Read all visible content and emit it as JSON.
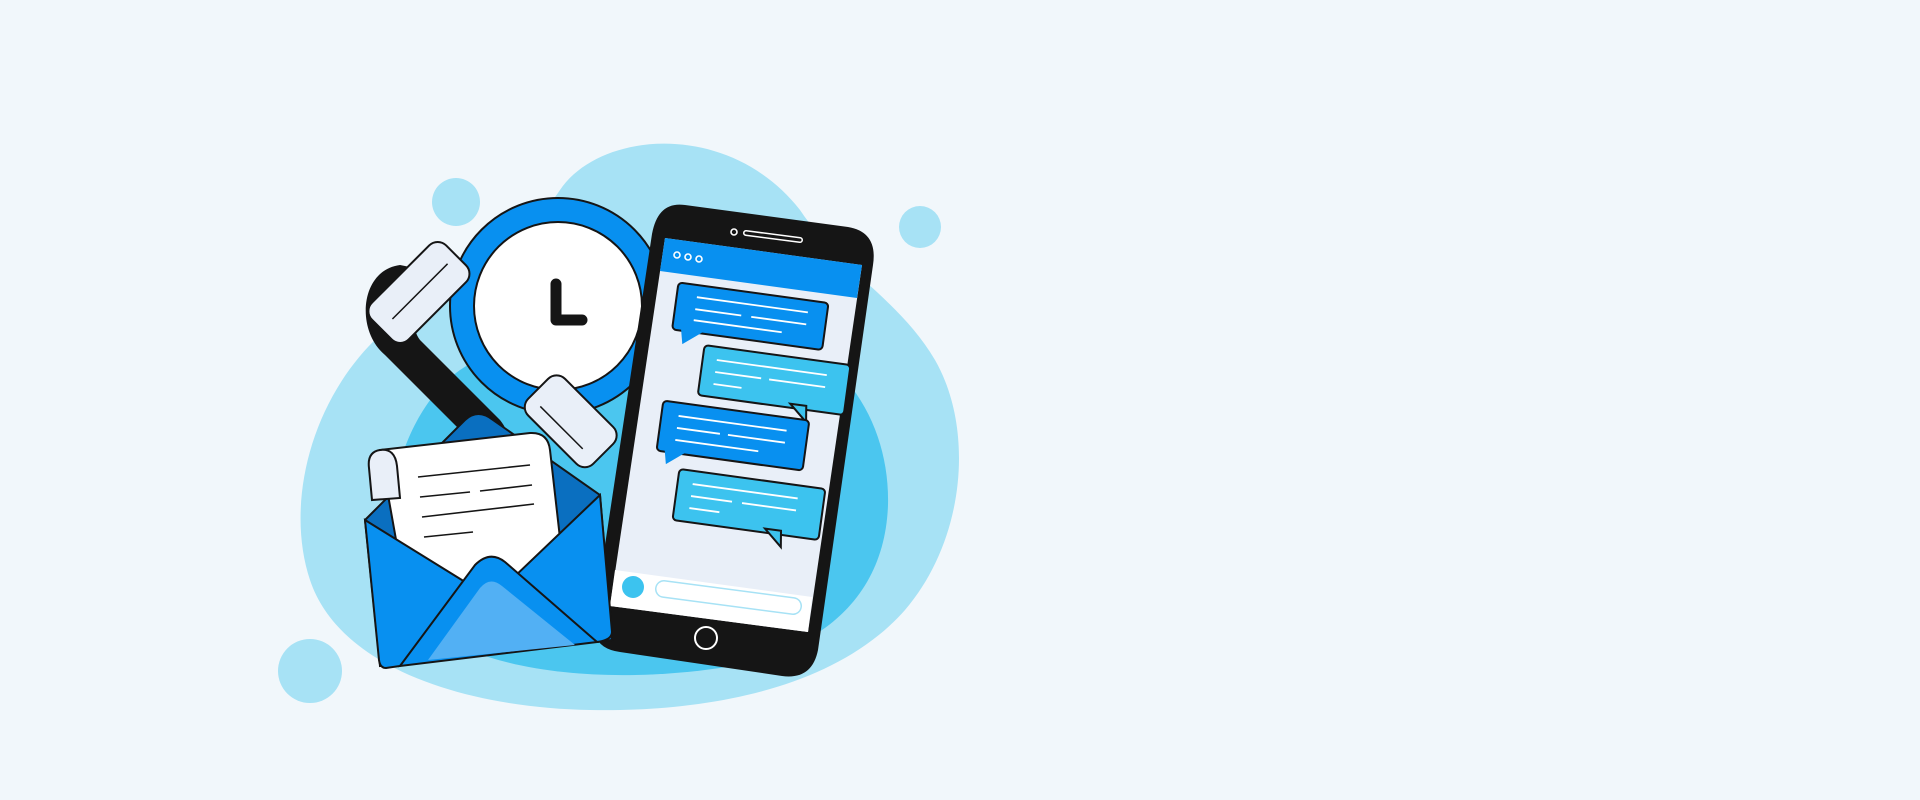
{
  "illustration": {
    "subject": "messaging-hero-graphic",
    "icons": [
      "clock-icon",
      "smartphone-icon",
      "chat-bubble-icon",
      "envelope-icon",
      "letter-icon",
      "dots-icon",
      "home-button-icon"
    ]
  },
  "colors": {
    "background": "#f1f7fb",
    "blob_light": "#a7e2f5",
    "blob_mid": "#4bc6ef",
    "accent_blue": "#0890f0",
    "accent_cyan": "#3cc3ef",
    "envelope_light": "#52b0f4",
    "envelope_dark": "#0a6fc0",
    "outline": "#151515",
    "screen": "#e9eff8",
    "paper": "#ffffff"
  },
  "phone": {
    "message_count": 4,
    "message_styles": [
      "blue",
      "cyan",
      "blue",
      "cyan"
    ]
  }
}
